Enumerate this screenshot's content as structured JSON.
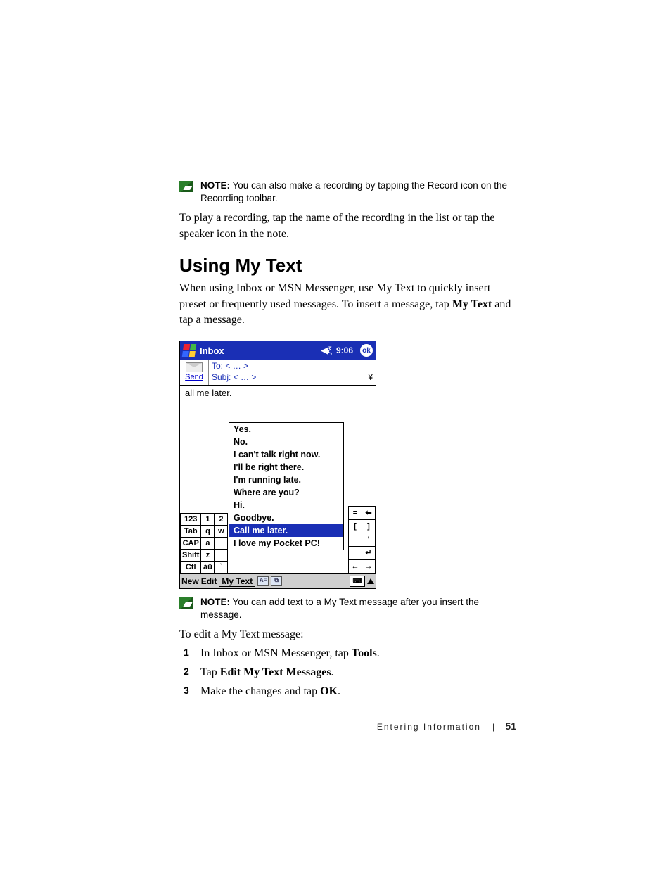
{
  "note1": {
    "label": "NOTE:",
    "text": "You can also make a recording by tapping the Record icon on the Recording toolbar."
  },
  "para1": "To play a recording, tap the name of the recording in the list or tap the speaker icon in the note.",
  "heading": "Using My Text",
  "para2_a": "When using Inbox or MSN Messenger, use My Text to quickly insert preset or frequently used messages. To insert a message, tap ",
  "para2_b": "My Text",
  "para2_c": " and tap a message.",
  "shot": {
    "title": "Inbox",
    "time": "9:06",
    "ok": "ok",
    "send": "Send",
    "to_label": "To:",
    "to_value": "< … >",
    "subj_label": "Subj:",
    "subj_value": "< … >",
    "body": "all me later.",
    "mytext": [
      "Yes.",
      "No.",
      "I can't talk right now.",
      "I'll be right there.",
      "I'm running late.",
      "Where are you?",
      "Hi.",
      "Goodbye.",
      "Call me later.",
      "I love my Pocket PC!"
    ],
    "mytext_selected_index": 8,
    "kb_left": [
      [
        "123",
        "1",
        "2"
      ],
      [
        "Tab",
        "q",
        "w"
      ],
      [
        "CAP",
        "a",
        ""
      ],
      [
        "Shift",
        "z",
        ""
      ],
      [
        "Ctl",
        "áü",
        "`"
      ]
    ],
    "kb_right": [
      [
        "=",
        "⬅"
      ],
      [
        "[",
        "]"
      ],
      [
        "",
        "'"
      ],
      [
        "",
        "↵"
      ],
      [
        "←",
        "→"
      ]
    ],
    "bottom": {
      "new": "New",
      "edit": "Edit",
      "mytext": "My Text"
    }
  },
  "note2": {
    "label": "NOTE:",
    "text": "You can add text to a My Text message after you insert the message."
  },
  "para3": "To edit a My Text message:",
  "steps": {
    "s1a": "In Inbox or MSN Messenger, tap ",
    "s1b": "Tools",
    "s1c": ".",
    "s2a": "Tap ",
    "s2b": "Edit My Text Messages",
    "s2c": ".",
    "s3a": "Make the changes and tap ",
    "s3b": "OK",
    "s3c": "."
  },
  "footer": {
    "section": "Entering Information",
    "sep": "|",
    "page": "51"
  }
}
